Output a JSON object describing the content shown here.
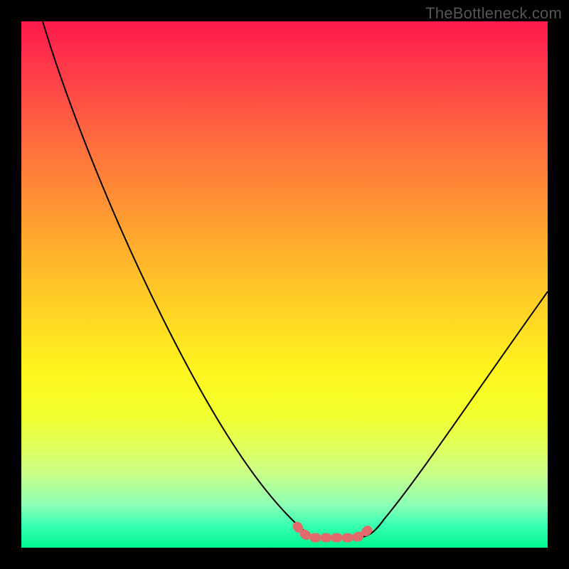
{
  "watermark": "TheBottleneck.com",
  "chart_data": {
    "type": "line",
    "title": "",
    "xlabel": "",
    "ylabel": "",
    "xlim": [
      0,
      100
    ],
    "ylim": [
      0,
      100
    ],
    "series": [
      {
        "name": "bottleneck-curve",
        "x": [
          4,
          10,
          20,
          30,
          40,
          48,
          52,
          56,
          58,
          60,
          63,
          68,
          72,
          80,
          90,
          100
        ],
        "values": [
          100,
          88,
          70,
          52,
          34,
          16,
          7,
          2,
          2,
          2,
          2,
          5,
          12,
          28,
          48,
          62
        ]
      }
    ],
    "highlight_band": {
      "name": "optimal-range",
      "x_start": 52,
      "x_end": 65,
      "y": 2,
      "color": "#e26a6a"
    },
    "background_gradient": {
      "top": "#ff1a4d",
      "mid": "#fff41e",
      "bottom": "#00f58f"
    }
  }
}
